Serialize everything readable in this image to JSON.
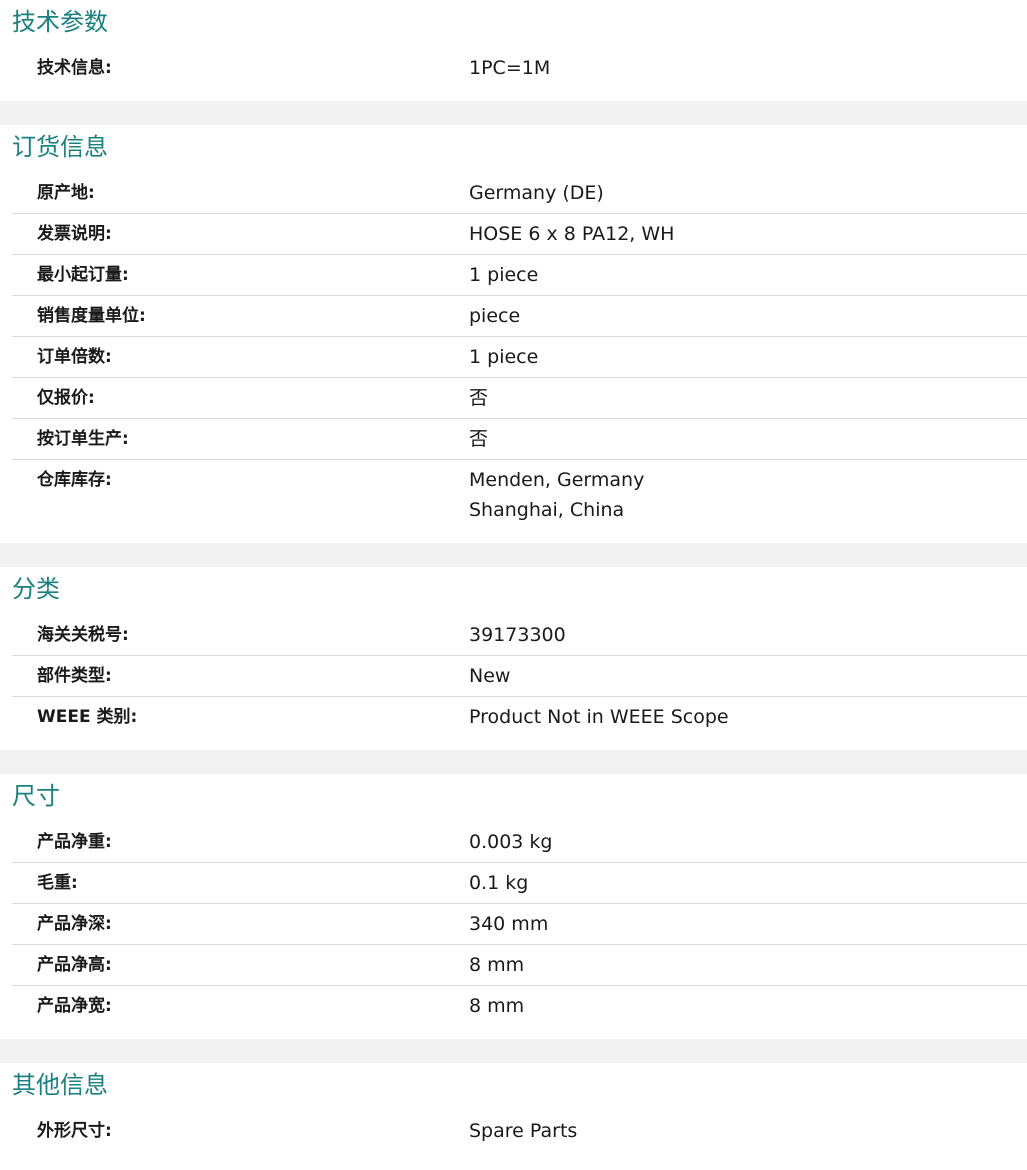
{
  "sections": [
    {
      "title": "技术参数",
      "rows": [
        {
          "label": "技术信息:",
          "value": [
            "1PC=1M"
          ]
        }
      ]
    },
    {
      "title": "订货信息",
      "rows": [
        {
          "label": "原产地:",
          "value": [
            "Germany (DE)"
          ]
        },
        {
          "label": "发票说明:",
          "value": [
            "HOSE 6 x 8 PA12, WH"
          ]
        },
        {
          "label": "最小起订量:",
          "value": [
            "1 piece"
          ]
        },
        {
          "label": "销售度量单位:",
          "value": [
            "piece"
          ]
        },
        {
          "label": "订单倍数:",
          "value": [
            "1 piece"
          ]
        },
        {
          "label": "仅报价:",
          "value": [
            "否"
          ]
        },
        {
          "label": "按订单生产:",
          "value": [
            "否"
          ]
        },
        {
          "label": "仓库库存:",
          "value": [
            "Menden, Germany",
            "Shanghai, China"
          ]
        }
      ]
    },
    {
      "title": "分类",
      "rows": [
        {
          "label": "海关关税号:",
          "value": [
            "39173300"
          ]
        },
        {
          "label": "部件类型:",
          "value": [
            "New"
          ]
        },
        {
          "label": "WEEE 类别:",
          "value": [
            "Product Not in WEEE Scope"
          ]
        }
      ]
    },
    {
      "title": "尺寸",
      "rows": [
        {
          "label": "产品净重:",
          "value": [
            "0.003 kg"
          ]
        },
        {
          "label": "毛重:",
          "value": [
            "0.1 kg"
          ]
        },
        {
          "label": "产品净深:",
          "value": [
            "340 mm"
          ]
        },
        {
          "label": "产品净高:",
          "value": [
            "8 mm"
          ]
        },
        {
          "label": "产品净宽:",
          "value": [
            "8 mm"
          ]
        }
      ]
    },
    {
      "title": "其他信息",
      "rows": [
        {
          "label": "外形尺寸:",
          "value": [
            "Spare  Parts"
          ]
        }
      ]
    }
  ]
}
